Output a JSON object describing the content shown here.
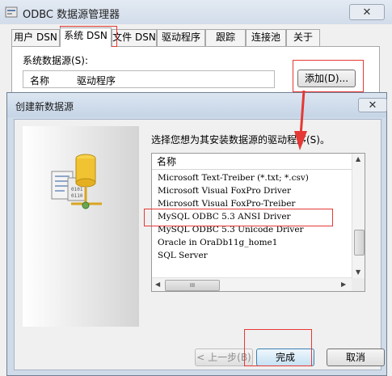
{
  "odbc_window": {
    "title": "ODBC 数据源管理器",
    "close_label": "✕",
    "tabs": [
      {
        "label": "用户 DSN"
      },
      {
        "label": "系统 DSN"
      },
      {
        "label": "文件 DSN"
      },
      {
        "label": "驱动程序"
      },
      {
        "label": "跟踪"
      },
      {
        "label": "连接池"
      },
      {
        "label": "关于"
      }
    ],
    "active_tab": "系统 DSN",
    "system_dsn_label": "系统数据源(S):",
    "columns": [
      "名称",
      "驱动程序"
    ],
    "add_button_label": "添加(D)..."
  },
  "dialog": {
    "title": "创建新数据源",
    "close_label": "✕",
    "prompt": "选择您想为其安装数据源的驱动程序(S)。",
    "list_header": "名称",
    "drivers": [
      "Microsoft Text-Treiber (*.txt; *.csv)",
      "Microsoft Visual FoxPro Driver",
      "Microsoft Visual FoxPro-Treiber",
      "MySQL ODBC 5.3 ANSI Driver",
      "MySQL ODBC 5.3 Unicode Driver",
      "Oracle in OraDb11g_home1",
      "SQL Server"
    ],
    "selected_driver": "MySQL ODBC 5.3 ANSI Driver",
    "hscroll_thumb": "III",
    "buttons": {
      "back": "< 上一步(B)",
      "finish": "完成",
      "cancel": "取消"
    }
  },
  "colors": {
    "annotation_red": "#e53935",
    "titlebar_blue": "#cfdbe9"
  }
}
